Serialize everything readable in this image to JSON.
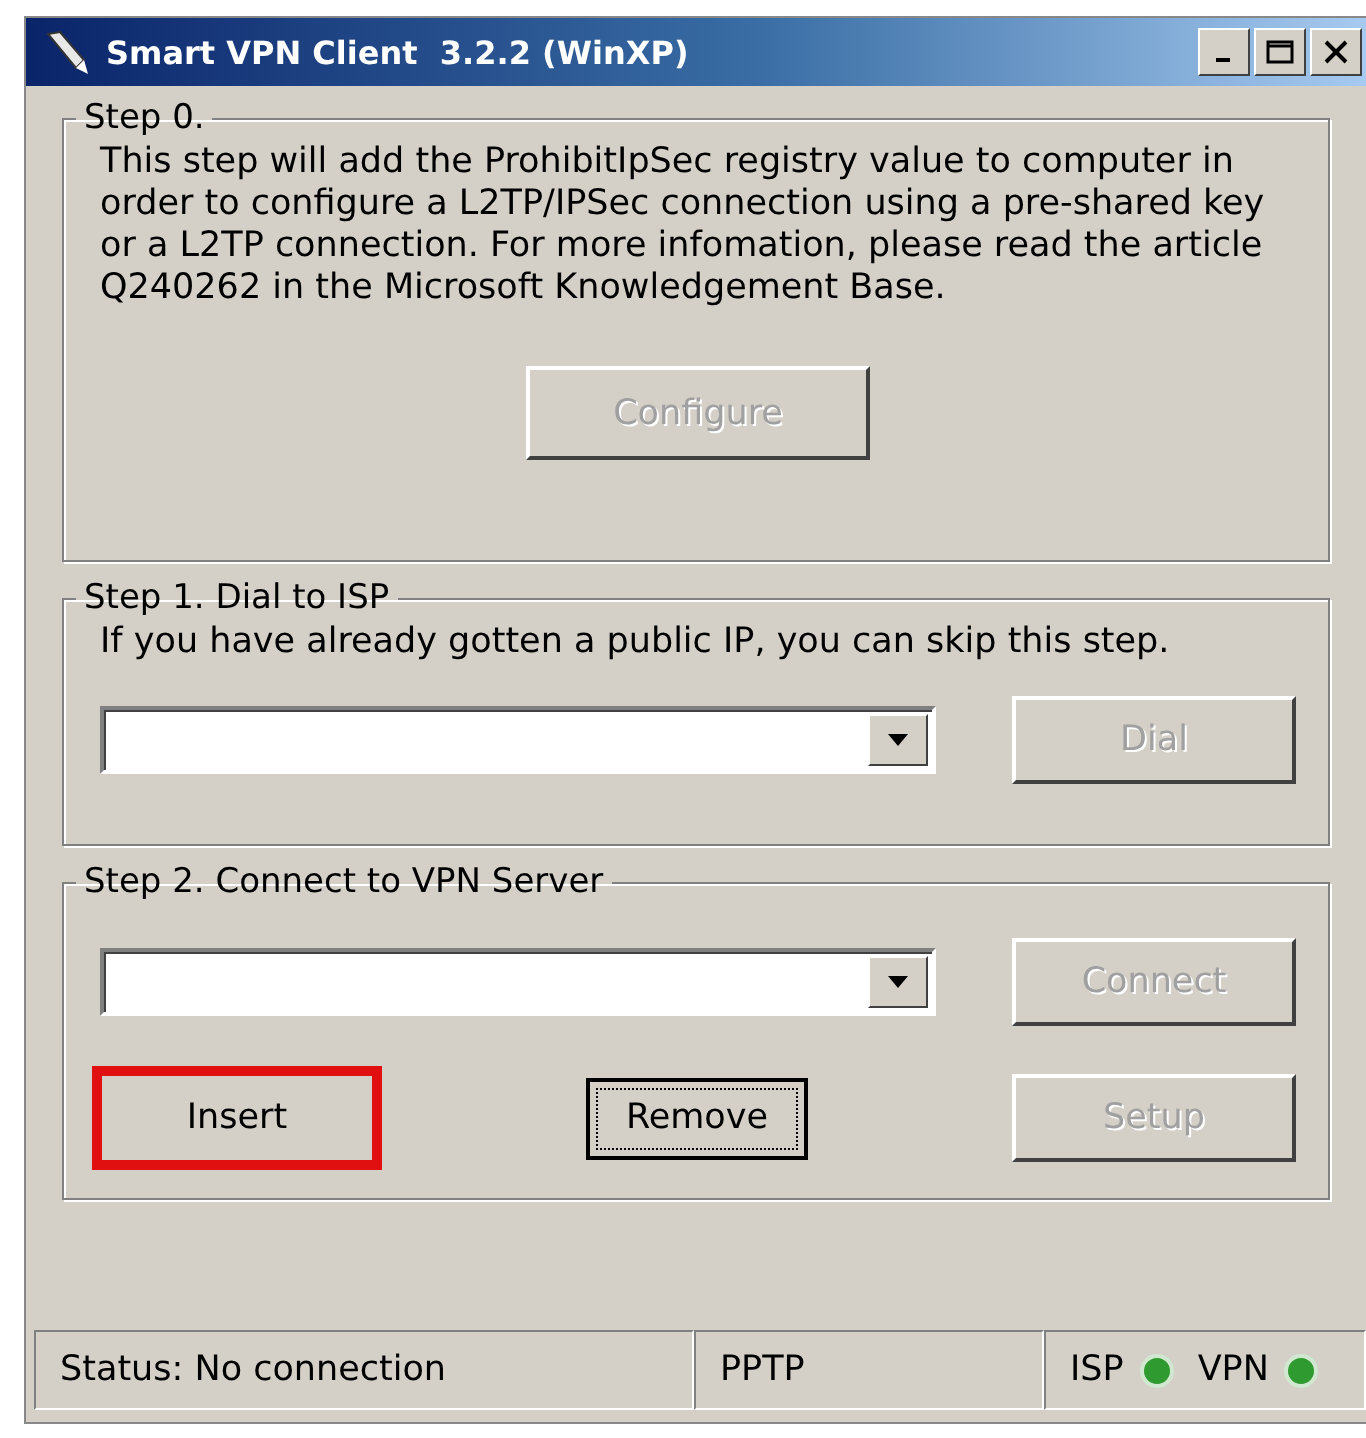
{
  "window": {
    "title": "Smart VPN Client  3.2.2 (WinXP)"
  },
  "groups": [
    {
      "title": "Step 0.",
      "description": "This step will add the ProhibitIpSec registry value to computer in order to configure a L2TP/IPSec connection using a pre-shared key or a L2TP connection. For more infomation, please read the article Q240262 in the Microsoft Knowledgement Base.",
      "rows": [
        {
          "items": [
            {
              "kind": "button",
              "label": "Configure",
              "disabled": true,
              "focused": false,
              "highlighted": false
            }
          ]
        }
      ]
    },
    {
      "title": "Step 1. Dial to ISP",
      "description": "If you have already gotten a public IP, you can skip this step.",
      "rows": [
        {
          "items": [
            {
              "kind": "dropdown"
            },
            {
              "kind": "button",
              "label": "Dial",
              "disabled": true,
              "focused": false,
              "highlighted": false
            }
          ]
        }
      ]
    },
    {
      "title": "Step 2. Connect to VPN Server",
      "rows": [
        {
          "items": [
            {
              "kind": "dropdown"
            },
            {
              "kind": "button",
              "label": "Connect",
              "disabled": true,
              "focused": false,
              "highlighted": false
            }
          ]
        },
        {
          "items": [
            {
              "kind": "button",
              "label": "Insert",
              "disabled": false,
              "focused": false,
              "highlighted": true
            },
            {
              "kind": "button",
              "label": "Remove",
              "disabled": false,
              "focused": true,
              "highlighted": false
            },
            {
              "kind": "button",
              "label": "Setup",
              "disabled": true,
              "focused": false,
              "highlighted": false
            }
          ]
        }
      ]
    }
  ],
  "status_bar": {
    "status": "Status: No connection",
    "protocol": "PPTP",
    "indicators": [
      {
        "label": "ISP",
        "color": "#2f9a2f"
      },
      {
        "label": "VPN",
        "color": "#2f9a2f"
      }
    ]
  }
}
